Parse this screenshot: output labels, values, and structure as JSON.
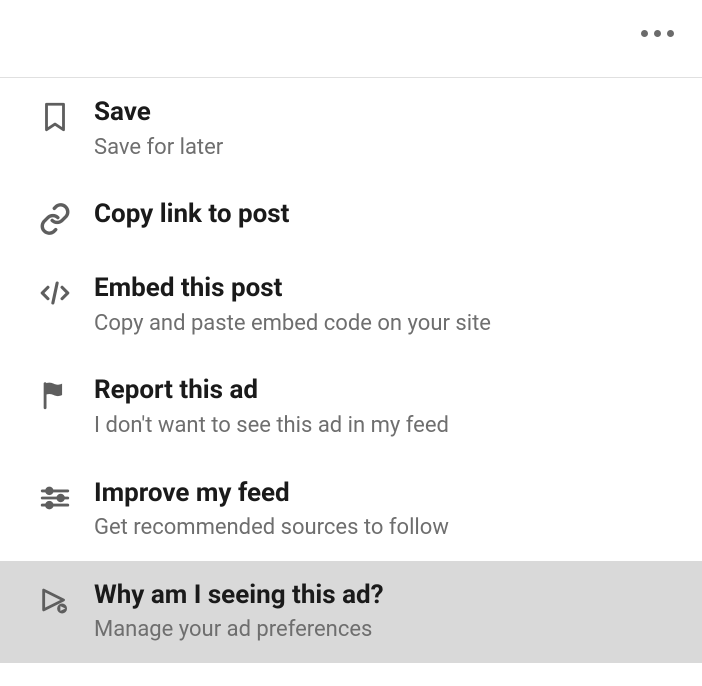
{
  "menu": {
    "items": [
      {
        "icon": "bookmark-icon",
        "title": "Save",
        "desc": "Save for later"
      },
      {
        "icon": "link-icon",
        "title": "Copy link to post",
        "desc": ""
      },
      {
        "icon": "code-icon",
        "title": "Embed this post",
        "desc": "Copy and paste embed code on your site"
      },
      {
        "icon": "flag-icon",
        "title": "Report this ad",
        "desc": "I don't want to see this ad in my feed"
      },
      {
        "icon": "sliders-icon",
        "title": "Improve my feed",
        "desc": "Get recommended sources to follow"
      },
      {
        "icon": "ad-play-icon",
        "title": "Why am I seeing this ad?",
        "desc": "Manage your ad preferences"
      }
    ]
  }
}
